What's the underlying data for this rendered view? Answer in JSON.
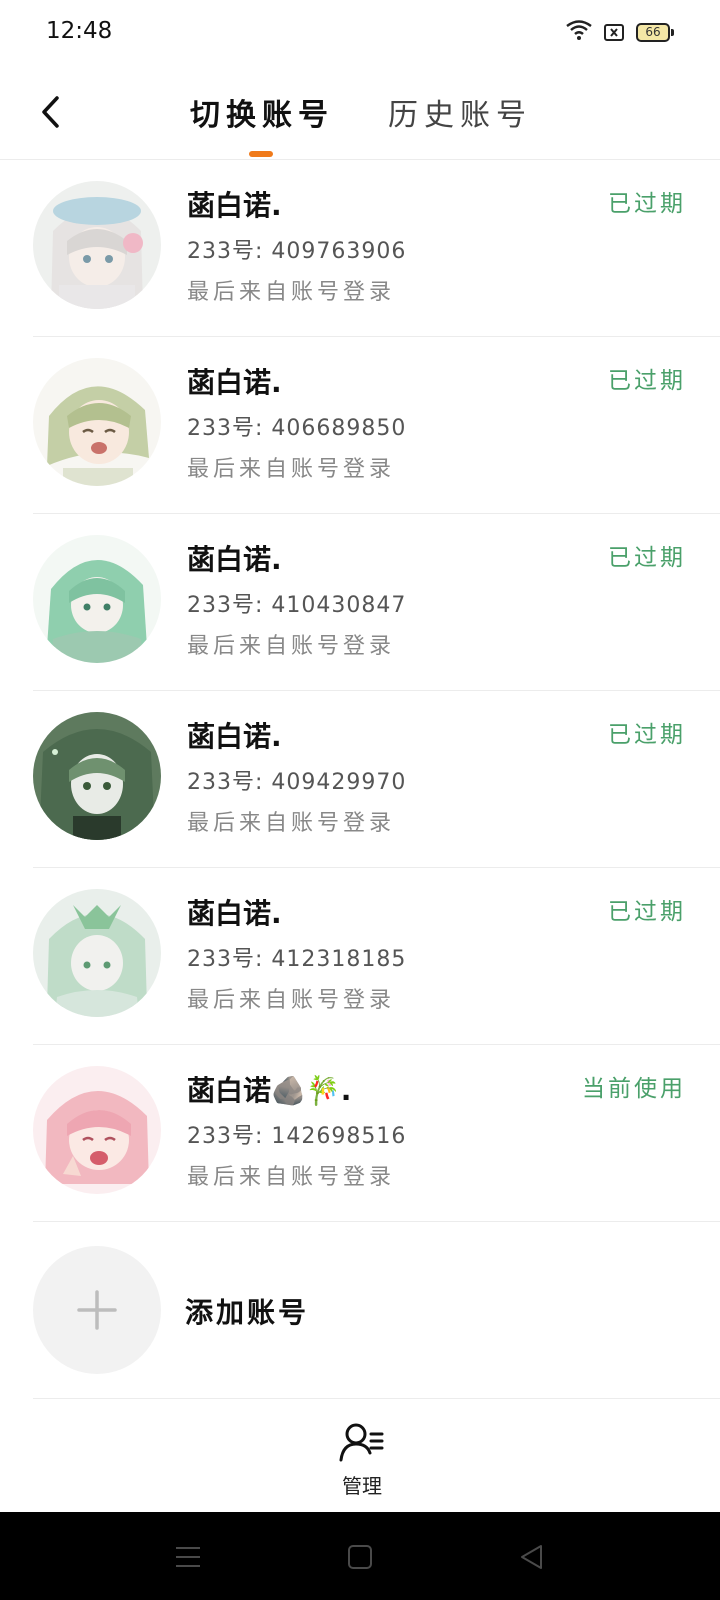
{
  "status_bar": {
    "time": "12:48",
    "battery": "66"
  },
  "header": {
    "tabs": [
      {
        "label": "切换账号",
        "active": true
      },
      {
        "label": "历史账号",
        "active": false
      }
    ],
    "accent": "#f07a1a"
  },
  "accounts": [
    {
      "name": "菡白诺.",
      "uid": "233号: 409763906",
      "last_login": "最后来自账号登录",
      "status": "已过期"
    },
    {
      "name": "菡白诺.",
      "uid": "233号: 406689850",
      "last_login": "最后来自账号登录",
      "status": "已过期"
    },
    {
      "name": "菡白诺.",
      "uid": "233号: 410430847",
      "last_login": "最后来自账号登录",
      "status": "已过期"
    },
    {
      "name": "菡白诺.",
      "uid": "233号: 409429970",
      "last_login": "最后来自账号登录",
      "status": "已过期"
    },
    {
      "name": "菡白诺.",
      "uid": "233号: 412318185",
      "last_login": "最后来自账号登录",
      "status": "已过期"
    },
    {
      "name": "菡白诺🪨🎋.",
      "uid": "233号: 142698516",
      "last_login": "最后来自账号登录",
      "status": "当前使用"
    }
  ],
  "add_account": {
    "label": "添加账号"
  },
  "bottom_tab": {
    "label": "管理",
    "icon": "user-manage-icon"
  },
  "colors": {
    "status_green": "#4aa06a",
    "divider": "#ececec"
  }
}
